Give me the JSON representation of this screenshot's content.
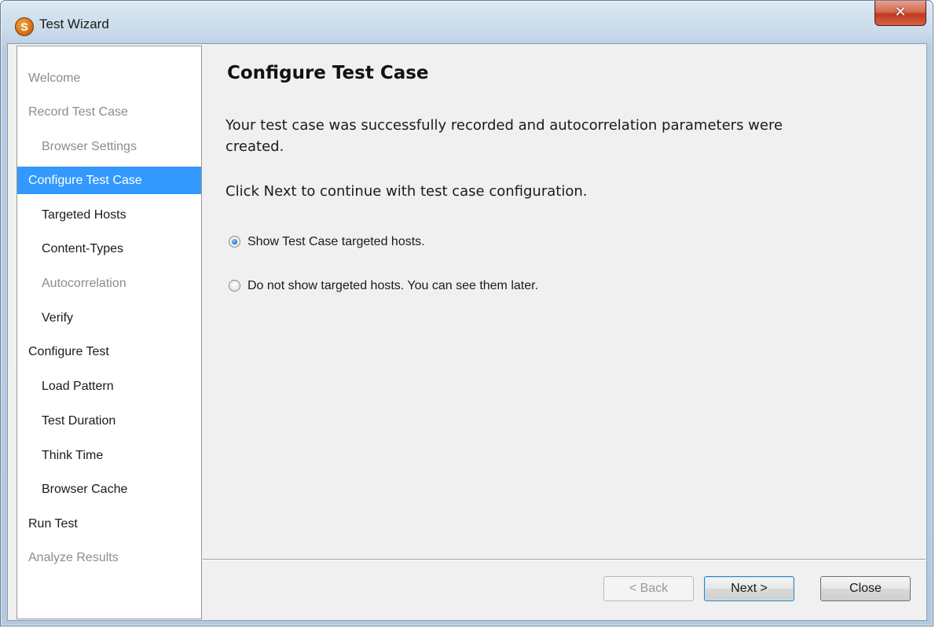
{
  "window": {
    "title": "Test Wizard",
    "app_icon_letter": "S",
    "close_glyph": "✕"
  },
  "sidebar": {
    "items": [
      {
        "label": "Welcome",
        "state": "disabled",
        "indent": 0
      },
      {
        "label": "Record Test Case",
        "state": "disabled",
        "indent": 0
      },
      {
        "label": "Browser Settings",
        "state": "disabled",
        "indent": 1
      },
      {
        "label": "Configure Test Case",
        "state": "selected",
        "indent": 0
      },
      {
        "label": "Targeted Hosts",
        "state": "enabled",
        "indent": 1
      },
      {
        "label": "Content-Types",
        "state": "enabled",
        "indent": 1
      },
      {
        "label": "Autocorrelation",
        "state": "disabled",
        "indent": 1
      },
      {
        "label": "Verify",
        "state": "enabled",
        "indent": 1
      },
      {
        "label": "Configure Test",
        "state": "enabled",
        "indent": 0
      },
      {
        "label": "Load Pattern",
        "state": "enabled",
        "indent": 1
      },
      {
        "label": "Test Duration",
        "state": "enabled",
        "indent": 1
      },
      {
        "label": "Think Time",
        "state": "enabled",
        "indent": 1
      },
      {
        "label": "Browser Cache",
        "state": "enabled",
        "indent": 1
      },
      {
        "label": "Run Test",
        "state": "enabled",
        "indent": 0
      },
      {
        "label": "Analyze Results",
        "state": "disabled",
        "indent": 0
      }
    ]
  },
  "main": {
    "heading": "Configure Test Case",
    "paragraph1_line1": "Your test case was successfully recorded and autocorrelation parameters were",
    "paragraph1_line2": "created.",
    "paragraph2": "Click Next to continue with test case configuration.",
    "options": [
      {
        "label": "Show Test Case targeted hosts.",
        "checked": true
      },
      {
        "label": "Do not show targeted hosts. You can see them later.",
        "checked": false
      }
    ]
  },
  "buttons": {
    "back": "< Back",
    "next": "Next >",
    "close": "Close"
  },
  "colors": {
    "selection": "#3399ff",
    "disabled_text": "#8c8c8c",
    "close_button": "#c0391d"
  }
}
